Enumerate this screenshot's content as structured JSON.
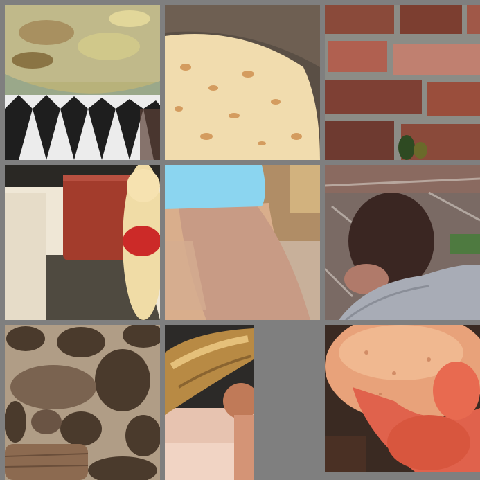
{
  "grid": {
    "background": "#7f7f7f",
    "rows": 3,
    "columns": 3
  },
  "tiles": [
    {
      "name": "tile-1",
      "subject": "casserole-dish-on-checkered-cloth",
      "colors": {
        "base": "#b8b27a",
        "accent": "#2a2a2a",
        "light": "#eeeeee"
      }
    },
    {
      "name": "tile-2",
      "subject": "flatbread-on-pan",
      "colors": {
        "base": "#f1dcae",
        "accent": "#c8813e",
        "light": "#5a4f45"
      }
    },
    {
      "name": "tile-3",
      "subject": "brick-wall",
      "colors": {
        "base": "#8a4a3a",
        "accent": "#b06050",
        "light": "#8c8c86"
      }
    },
    {
      "name": "tile-4",
      "subject": "cake-slice-on-slate",
      "colors": {
        "base": "#a33c2c",
        "accent": "#4f4a40",
        "light": "#efe7d6"
      }
    },
    {
      "name": "tile-5",
      "subject": "arm-in-blue-shirt",
      "colors": {
        "base": "#c89b85",
        "accent": "#8bd5f0",
        "light": "#d9ae8c"
      }
    },
    {
      "name": "tile-6",
      "subject": "child-head-on-blanket",
      "colors": {
        "base": "#3a2622",
        "accent": "#a8acb6",
        "light": "#7a6a64"
      }
    },
    {
      "name": "tile-7",
      "subject": "stone-wall",
      "colors": {
        "base": "#7a6350",
        "accent": "#4a3a2c",
        "light": "#b09d86"
      }
    },
    {
      "name": "tile-8",
      "subject": "bread-stick-held-in-hand",
      "colors": {
        "base": "#b88a44",
        "accent": "#e5c07a",
        "light": "#f1d4c4"
      }
    },
    {
      "name": "tile-9",
      "subject": "cookie-held-in-fingers",
      "colors": {
        "base": "#e8a27a",
        "accent": "#e0624c",
        "light": "#3a2a22"
      }
    }
  ]
}
